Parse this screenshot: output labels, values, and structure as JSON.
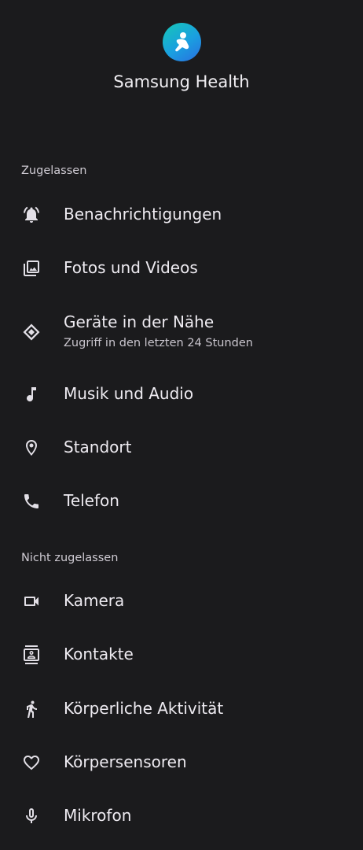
{
  "app": {
    "name": "Samsung Health"
  },
  "allowed": {
    "label": "Zugelassen",
    "items": [
      {
        "title": "Benachrichtigungen",
        "icon": "notification-bell-icon"
      },
      {
        "title": "Fotos und Videos",
        "icon": "photo-library-icon"
      },
      {
        "title": "Geräte in der Nähe",
        "subtitle": "Zugriff in den letzten 24 Stunden",
        "icon": "nearby-devices-icon"
      },
      {
        "title": "Musik und Audio",
        "icon": "music-note-icon"
      },
      {
        "title": "Standort",
        "icon": "location-pin-icon"
      },
      {
        "title": "Telefon",
        "icon": "phone-icon"
      }
    ]
  },
  "not_allowed": {
    "label": "Nicht zugelassen",
    "items": [
      {
        "title": "Kamera",
        "icon": "camera-icon"
      },
      {
        "title": "Kontakte",
        "icon": "contacts-icon"
      },
      {
        "title": "Körperliche Aktivität",
        "icon": "running-person-icon"
      },
      {
        "title": "Körpersensoren",
        "icon": "heart-icon"
      },
      {
        "title": "Mikrofon",
        "icon": "microphone-icon"
      }
    ]
  }
}
